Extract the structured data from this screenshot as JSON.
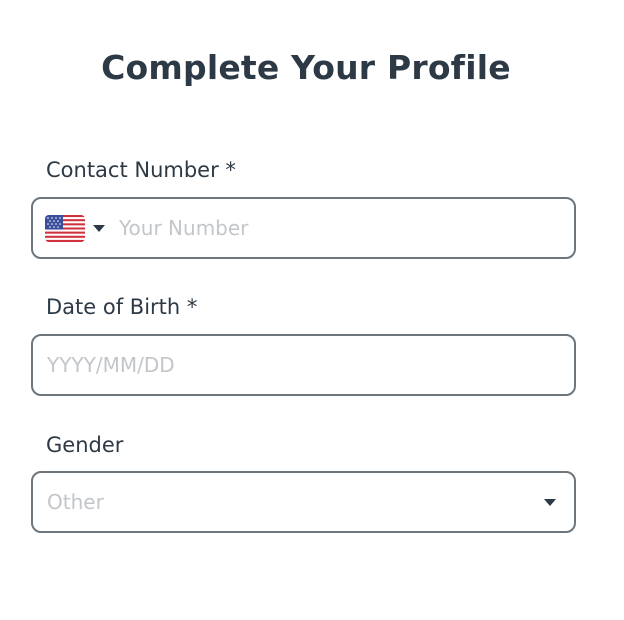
{
  "title": "Complete Your Profile",
  "contact": {
    "label": "Contact Number *",
    "country_icon": "us-flag-icon",
    "placeholder": "Your Number"
  },
  "dob": {
    "label": "Date of Birth *",
    "placeholder": "YYYY/MM/DD"
  },
  "gender": {
    "label": "Gender",
    "selected": "Other"
  },
  "colors": {
    "text": "#2d3a45",
    "border": "#6e767d",
    "placeholder": "#c2c6ca"
  }
}
